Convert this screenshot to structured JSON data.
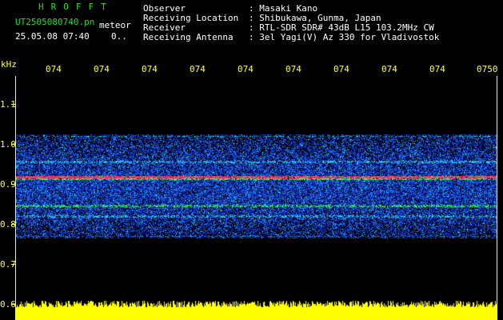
{
  "header": {
    "logo": "HROFFT",
    "filename": "UT2505080740.pn",
    "meteor_label": "meteor",
    "timestamp": "25.05.08 07:40",
    "count": "0..",
    "rows": [
      {
        "label": "Observer",
        "value": ": Masaki Kano"
      },
      {
        "label": "Receiving Location",
        "value": ": Shibukawa, Gunma, Japan"
      },
      {
        "label": "Receiver",
        "value": ": RTL-SDR SDR# 43dB L15 103.2MHz CW"
      },
      {
        "label": "Receiving Antenna",
        "value": ": 3el Yagi(V) Az 330 for Vladivostok"
      }
    ]
  },
  "spectrogram": {
    "unit_label": "kHz",
    "time_labels": [
      "074",
      "074",
      "074",
      "074",
      "074",
      "074",
      "074",
      "074",
      "074",
      "0750"
    ],
    "freq_labels": [
      "1.1",
      "1.0",
      "0.9",
      "0.8",
      "0.7",
      "0.6"
    ],
    "colors": {
      "background": "#000000",
      "noise_low": "#0a1a8c",
      "noise_mid": "#1e6cff",
      "noise_high": "#22ddee",
      "carrier": "#ff2a55",
      "sideband": "#33ff55",
      "signal_strip": "#ffff00"
    }
  }
}
